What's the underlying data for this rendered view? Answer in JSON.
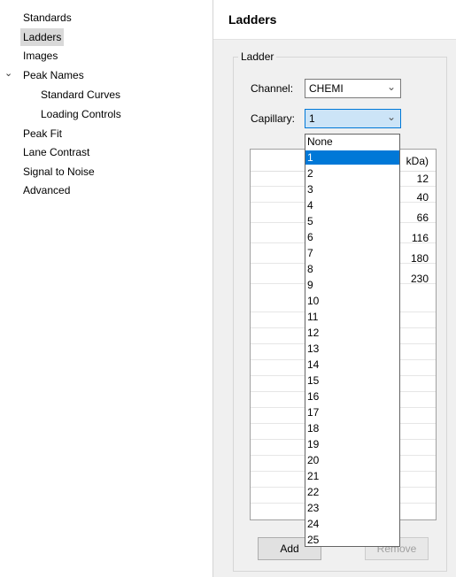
{
  "nav": {
    "items": [
      {
        "label": "Standards",
        "indent": 0
      },
      {
        "label": "Ladders",
        "indent": 0,
        "selected": true
      },
      {
        "label": "Images",
        "indent": 0
      },
      {
        "label": "Peak Names",
        "indent": 0,
        "expanded": true
      },
      {
        "label": "Standard Curves",
        "indent": 1
      },
      {
        "label": "Loading Controls",
        "indent": 1
      },
      {
        "label": "Peak Fit",
        "indent": 0
      },
      {
        "label": "Lane Contrast",
        "indent": 0
      },
      {
        "label": "Signal to Noise",
        "indent": 0
      },
      {
        "label": "Advanced",
        "indent": 0
      }
    ]
  },
  "panel": {
    "title": "Ladders",
    "group_label": "Ladder",
    "channel_label": "Channel:",
    "channel_value": "CHEMI",
    "capillary_label": "Capillary:",
    "capillary_value": "1",
    "table_header_visible": "kDa)",
    "table_values": [
      "12",
      "40",
      "66",
      "116",
      "180",
      "230"
    ],
    "add_button": "Add",
    "remove_button": "Remove"
  },
  "dropdown": {
    "options": [
      "None",
      "1",
      "2",
      "3",
      "4",
      "5",
      "6",
      "7",
      "8",
      "9",
      "10",
      "11",
      "12",
      "13",
      "14",
      "15",
      "16",
      "17",
      "18",
      "19",
      "20",
      "21",
      "22",
      "23",
      "24",
      "25"
    ],
    "selected": "1"
  }
}
